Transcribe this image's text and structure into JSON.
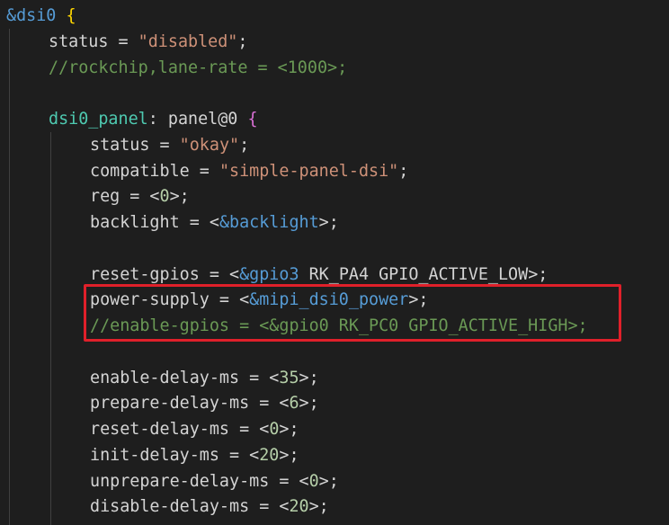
{
  "editor": {
    "lines": [
      {
        "indent": 0,
        "tokens": [
          {
            "t": "&dsi0",
            "c": "k-ref"
          },
          {
            "t": " ",
            "c": "k-prop"
          },
          {
            "t": "{",
            "c": "k-brace-y"
          }
        ]
      },
      {
        "indent": 1,
        "tokens": [
          {
            "t": "status = ",
            "c": "k-prop"
          },
          {
            "t": "\"disabled\"",
            "c": "k-str"
          },
          {
            "t": ";",
            "c": "k-prop"
          }
        ]
      },
      {
        "indent": 1,
        "tokens": [
          {
            "t": "//rockchip,lane-rate = <1000>;",
            "c": "k-comment"
          }
        ]
      },
      {
        "indent": 0,
        "tokens": []
      },
      {
        "indent": 1,
        "tokens": [
          {
            "t": "dsi0_panel",
            "c": "k-label"
          },
          {
            "t": ": panel@0 ",
            "c": "k-prop"
          },
          {
            "t": "{",
            "c": "k-brace-p"
          }
        ]
      },
      {
        "indent": 2,
        "tokens": [
          {
            "t": "status = ",
            "c": "k-prop"
          },
          {
            "t": "\"okay\"",
            "c": "k-str"
          },
          {
            "t": ";",
            "c": "k-prop"
          }
        ]
      },
      {
        "indent": 2,
        "tokens": [
          {
            "t": "compatible = ",
            "c": "k-prop"
          },
          {
            "t": "\"simple-panel-dsi\"",
            "c": "k-str"
          },
          {
            "t": ";",
            "c": "k-prop"
          }
        ]
      },
      {
        "indent": 2,
        "tokens": [
          {
            "t": "reg = <",
            "c": "k-prop"
          },
          {
            "t": "0",
            "c": "k-num"
          },
          {
            "t": ">;",
            "c": "k-prop"
          }
        ]
      },
      {
        "indent": 2,
        "tokens": [
          {
            "t": "backlight = <",
            "c": "k-prop"
          },
          {
            "t": "&backlight",
            "c": "k-ref"
          },
          {
            "t": ">;",
            "c": "k-prop"
          }
        ]
      },
      {
        "indent": 0,
        "tokens": []
      },
      {
        "indent": 2,
        "tokens": [
          {
            "t": "reset-gpios = <",
            "c": "k-prop"
          },
          {
            "t": "&gpio3",
            "c": "k-ref"
          },
          {
            "t": " RK_PA4 GPIO_ACTIVE_LOW>;",
            "c": "k-prop"
          }
        ]
      },
      {
        "indent": 2,
        "tokens": [
          {
            "t": "power-supply = <",
            "c": "k-prop"
          },
          {
            "t": "&mipi_dsi0_power",
            "c": "k-ref"
          },
          {
            "t": ">;",
            "c": "k-prop"
          }
        ]
      },
      {
        "indent": 2,
        "tokens": [
          {
            "t": "//enable-gpios = <&gpio0 RK_PC0 GPIO_ACTIVE_HIGH>;",
            "c": "k-comment"
          }
        ]
      },
      {
        "indent": 0,
        "tokens": []
      },
      {
        "indent": 2,
        "tokens": [
          {
            "t": "enable-delay-ms = <",
            "c": "k-prop"
          },
          {
            "t": "35",
            "c": "k-num"
          },
          {
            "t": ">;",
            "c": "k-prop"
          }
        ]
      },
      {
        "indent": 2,
        "tokens": [
          {
            "t": "prepare-delay-ms = <",
            "c": "k-prop"
          },
          {
            "t": "6",
            "c": "k-num"
          },
          {
            "t": ">;",
            "c": "k-prop"
          }
        ]
      },
      {
        "indent": 2,
        "tokens": [
          {
            "t": "reset-delay-ms = <",
            "c": "k-prop"
          },
          {
            "t": "0",
            "c": "k-num"
          },
          {
            "t": ">;",
            "c": "k-prop"
          }
        ]
      },
      {
        "indent": 2,
        "tokens": [
          {
            "t": "init-delay-ms = <",
            "c": "k-prop"
          },
          {
            "t": "20",
            "c": "k-num"
          },
          {
            "t": ">;",
            "c": "k-prop"
          }
        ]
      },
      {
        "indent": 2,
        "tokens": [
          {
            "t": "unprepare-delay-ms = <",
            "c": "k-prop"
          },
          {
            "t": "0",
            "c": "k-num"
          },
          {
            "t": ">;",
            "c": "k-prop"
          }
        ]
      },
      {
        "indent": 2,
        "tokens": [
          {
            "t": "disable-delay-ms = <",
            "c": "k-prop"
          },
          {
            "t": "20",
            "c": "k-num"
          },
          {
            "t": ">;",
            "c": "k-prop"
          }
        ]
      }
    ]
  },
  "highlight": {
    "color": "#e0202a",
    "lines": "12-13"
  }
}
